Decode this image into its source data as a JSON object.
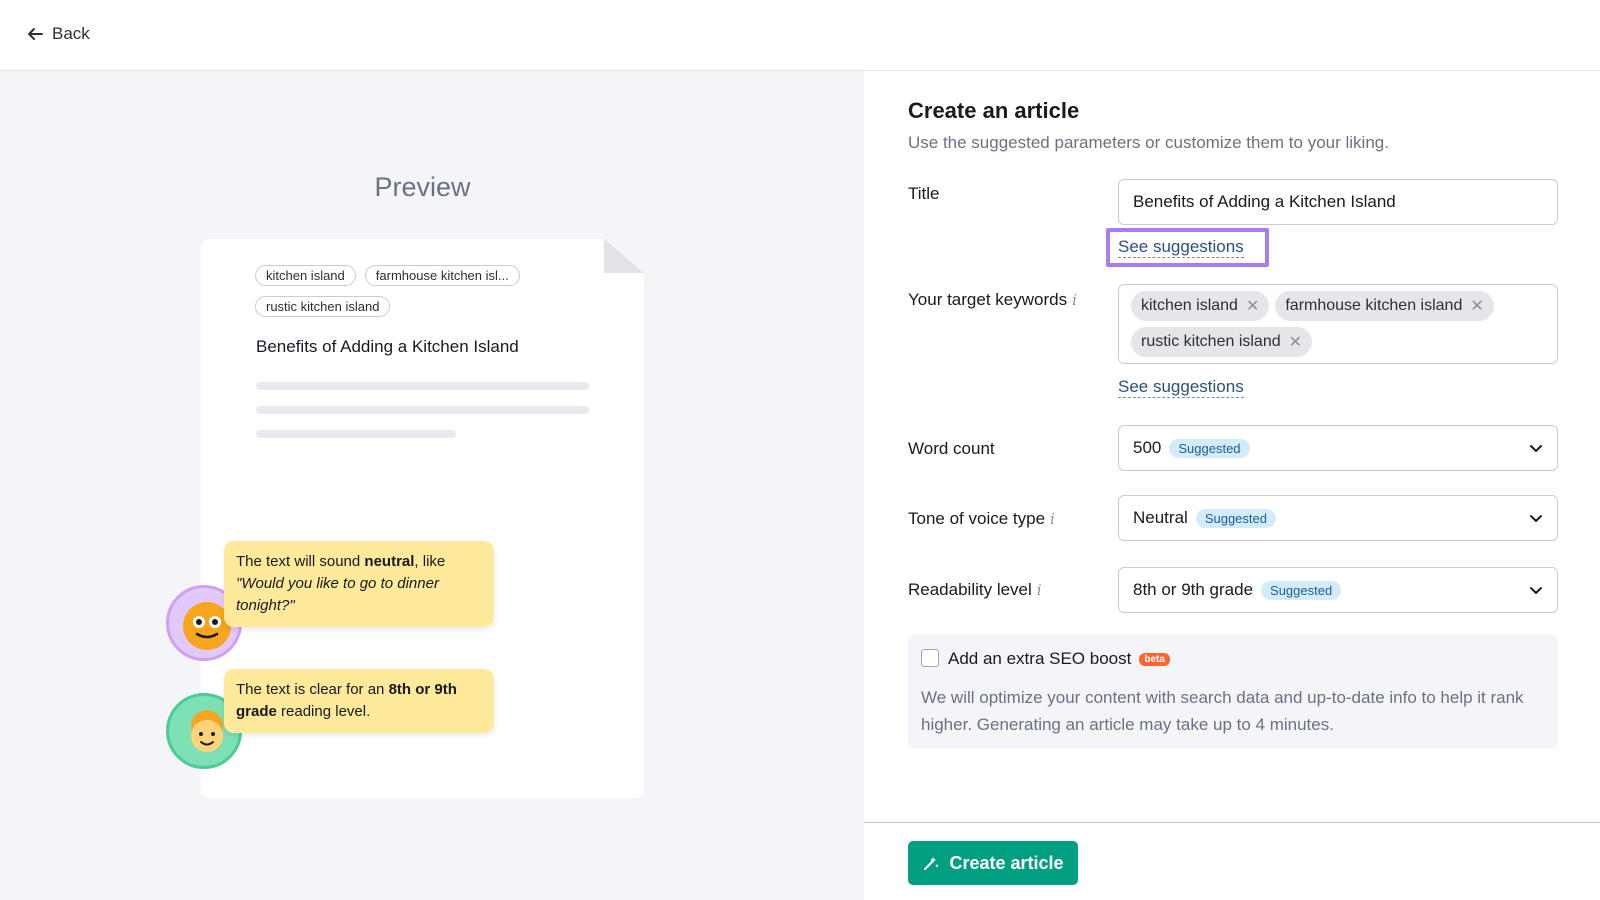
{
  "nav": {
    "back_label": "Back"
  },
  "preview": {
    "heading": "Preview",
    "chips": [
      "kitchen island",
      "farmhouse kitchen isl...",
      "rustic kitchen island"
    ],
    "doc_title": "Benefits of Adding a Kitchen Island",
    "bubble1": {
      "pre": "The text will sound ",
      "bold": "neutral",
      "post": ", like ",
      "quote": "\"Would you like to go to dinner tonight?\""
    },
    "bubble2": {
      "pre": "The text is clear for an ",
      "bold": "8th or 9th grade",
      "post": " reading level."
    }
  },
  "form": {
    "heading": "Create an article",
    "subheading": "Use the suggested parameters or customize them to your liking.",
    "title_label": "Title",
    "title_value": "Benefits of Adding a Kitchen Island",
    "see_suggestions": "See suggestions",
    "keywords_label": "Your target keywords",
    "keywords": [
      "kitchen island",
      "farmhouse kitchen island",
      "rustic kitchen island"
    ],
    "word_count_label": "Word count",
    "word_count_value": "500",
    "tone_label": "Tone of voice type",
    "tone_value": "Neutral",
    "readability_label": "Readability level",
    "readability_value": "8th or 9th grade",
    "suggested_badge": "Suggested",
    "info_glyph": "i",
    "remove_glyph": "✕",
    "seo": {
      "label": "Add an extra SEO boost",
      "badge": "beta",
      "description": "We will optimize your content with search data and up-to-date info to help it rank higher. Generating an article may take up to 4 minutes."
    },
    "create_button": "Create article"
  },
  "colors": {
    "accent_green": "#009f81",
    "highlight_purple": "#a97cf7",
    "beta_orange": "#ff642d",
    "bubble_yellow": "#ffe99b",
    "badge_blue": "#d3ecfb"
  }
}
